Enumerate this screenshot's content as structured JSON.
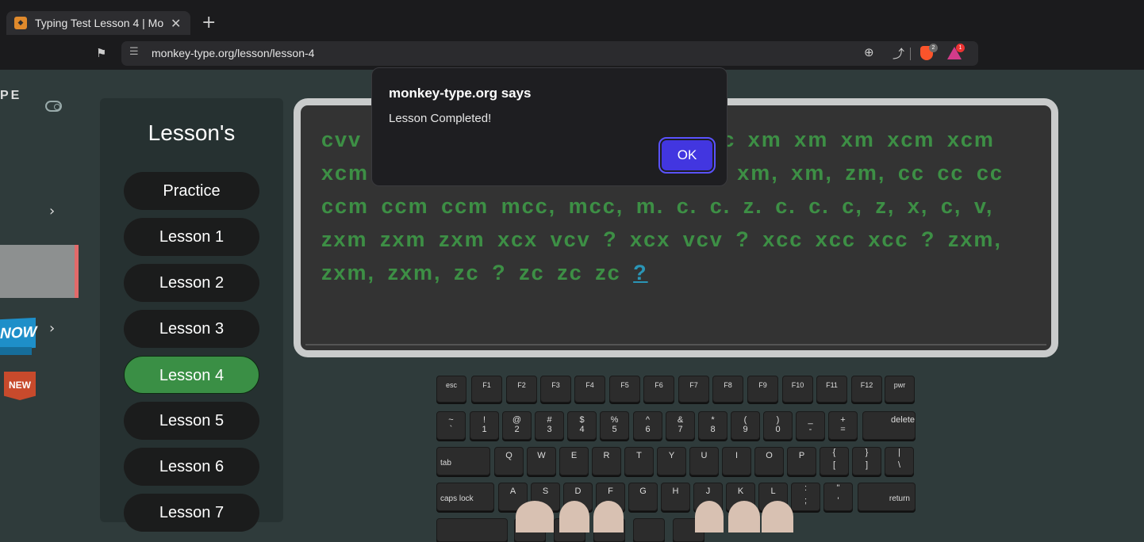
{
  "browser": {
    "tab_title": "Typing Test Lesson 4 | Mo",
    "tab_close": "✕",
    "new_tab": "+",
    "url": "monkey-type.org/lesson/lesson-4",
    "brave_badge": "2",
    "rewards_badge": "1"
  },
  "site": {
    "brand_fragment": "PE",
    "now_banner": "NOW",
    "new_badge": "NEW",
    "accent_color": "#3a8f45"
  },
  "sidebar": {
    "title": "Lesson's",
    "items": [
      {
        "label": "Practice"
      },
      {
        "label": "Lesson 1"
      },
      {
        "label": "Lesson 2"
      },
      {
        "label": "Lesson 3"
      },
      {
        "label": "Lesson 4",
        "active": true
      },
      {
        "label": "Lesson 5"
      },
      {
        "label": "Lesson 6"
      },
      {
        "label": "Lesson 7"
      }
    ]
  },
  "typing": {
    "text_before": "cvv cvv cvv mmc mmc mmc mmc xm xm xm xcm xcm xcm xcm mcc, mcc, mcc, cc, cc, xm, xm, zm, cc cc cc ccm ccm ccm mcc, mcc, m. c. c. z. c. c. c, z, x, c, v, zxm zxm zxm xcx vcv ? xcx vcv ? xcc xcc xcc ? zxm, zxm, zxm, zc ? zc zc zc",
    "current_char": "?"
  },
  "keyboard": {
    "row0": [
      "esc",
      "F1",
      "F2",
      "F3",
      "F4",
      "F5",
      "F6",
      "F7",
      "F8",
      "F9",
      "F10",
      "F11",
      "F12",
      "pwr"
    ],
    "row1": [
      [
        "~",
        "`"
      ],
      [
        "!",
        "1"
      ],
      [
        "@",
        "2"
      ],
      [
        "#",
        "3"
      ],
      [
        "$",
        "4"
      ],
      [
        "%",
        "5"
      ],
      [
        "^",
        "6"
      ],
      [
        "&",
        "7"
      ],
      [
        "*",
        "8"
      ],
      [
        "(",
        "9"
      ],
      [
        ")",
        "0"
      ],
      [
        "_",
        "-"
      ],
      [
        "+",
        "="
      ],
      [
        "",
        "delete"
      ]
    ],
    "row2": [
      [
        "",
        "tab"
      ],
      [
        "",
        "Q"
      ],
      [
        "",
        "W"
      ],
      [
        "",
        "E"
      ],
      [
        "",
        "R"
      ],
      [
        "",
        "T"
      ],
      [
        "",
        "Y"
      ],
      [
        "",
        "U"
      ],
      [
        "",
        "I"
      ],
      [
        "",
        "O"
      ],
      [
        "",
        "P"
      ],
      [
        "{",
        "["
      ],
      [
        "}",
        "]"
      ],
      [
        "|",
        "\\"
      ]
    ],
    "row3": [
      [
        "",
        "caps lock"
      ],
      [
        "",
        "A"
      ],
      [
        "",
        "S"
      ],
      [
        "",
        "D"
      ],
      [
        "",
        "F"
      ],
      [
        "",
        "G"
      ],
      [
        "",
        "H"
      ],
      [
        "",
        "J"
      ],
      [
        "",
        "K"
      ],
      [
        "",
        "L"
      ],
      [
        ":",
        ";"
      ],
      [
        "\"",
        "'"
      ],
      [
        "",
        "return"
      ]
    ]
  },
  "dialog": {
    "title": "monkey-type.org says",
    "message": "Lesson Completed!",
    "ok_label": "OK"
  }
}
